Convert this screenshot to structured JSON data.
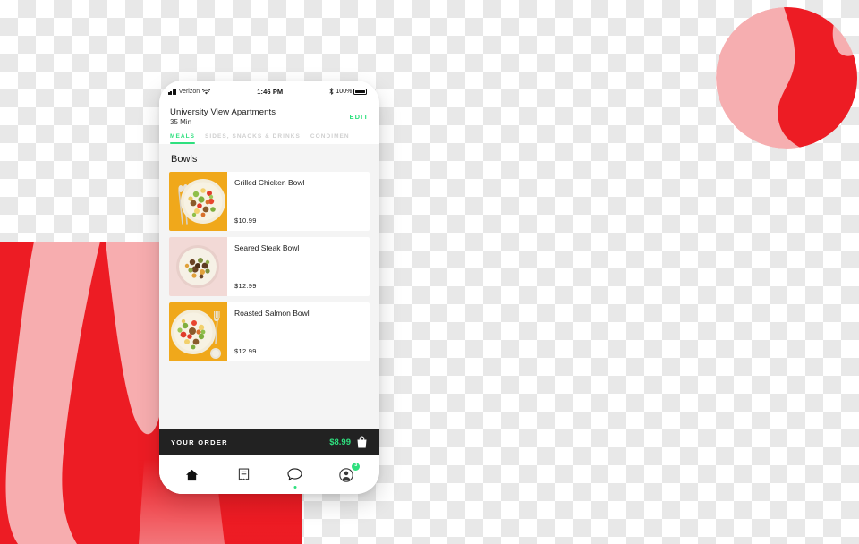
{
  "background": {
    "circle": {
      "name": "decorative-circle",
      "base_color": "#f6aeb0",
      "accent_color": "#ed1c24"
    },
    "block": {
      "name": "decorative-red-block",
      "base_color": "#ed1c24",
      "accent_color": "#f7adaf"
    }
  },
  "phone": {
    "status_bar": {
      "carrier": "Verizon",
      "time": "1:46 PM",
      "battery_percent": "100%",
      "signal_icon": "signal-bars-icon",
      "wifi_icon": "wifi-icon",
      "bluetooth_icon": "bluetooth-icon",
      "battery_icon": "battery-icon"
    },
    "header": {
      "title": "University View Apartments",
      "subtitle": "35 Min",
      "edit_label": "EDIT",
      "edit_color": "#2ee07e"
    },
    "tabs": [
      {
        "label": "MEALS",
        "active": true
      },
      {
        "label": "SIDES, SNACKS & DRINKS",
        "active": false
      },
      {
        "label": "CONDIMEN",
        "active": false
      }
    ],
    "section": {
      "title": "Bowls"
    },
    "items": [
      {
        "name": "Grilled Chicken Bowl",
        "price": "$10.99",
        "bg": "#f0a81b"
      },
      {
        "name": "Seared Steak Bowl",
        "price": "$12.99",
        "bg": "#f2d9d6"
      },
      {
        "name": "Roasted Salmon Bowl",
        "price": "$12.99",
        "bg": "#f0a81b"
      }
    ],
    "order_bar": {
      "label": "YOUR ORDER",
      "total": "$8.99",
      "total_color": "#2ee07e",
      "bag_icon": "shopping-bag-icon",
      "bar_color": "#222222"
    },
    "bottom_nav": [
      {
        "icon": "home-icon",
        "active": true,
        "dot": false,
        "badge": null
      },
      {
        "icon": "receipt-icon",
        "active": false,
        "dot": false,
        "badge": null
      },
      {
        "icon": "chat-bubble-icon",
        "active": false,
        "dot": true,
        "badge": null
      },
      {
        "icon": "profile-icon",
        "active": false,
        "dot": false,
        "badge": "3"
      }
    ]
  }
}
